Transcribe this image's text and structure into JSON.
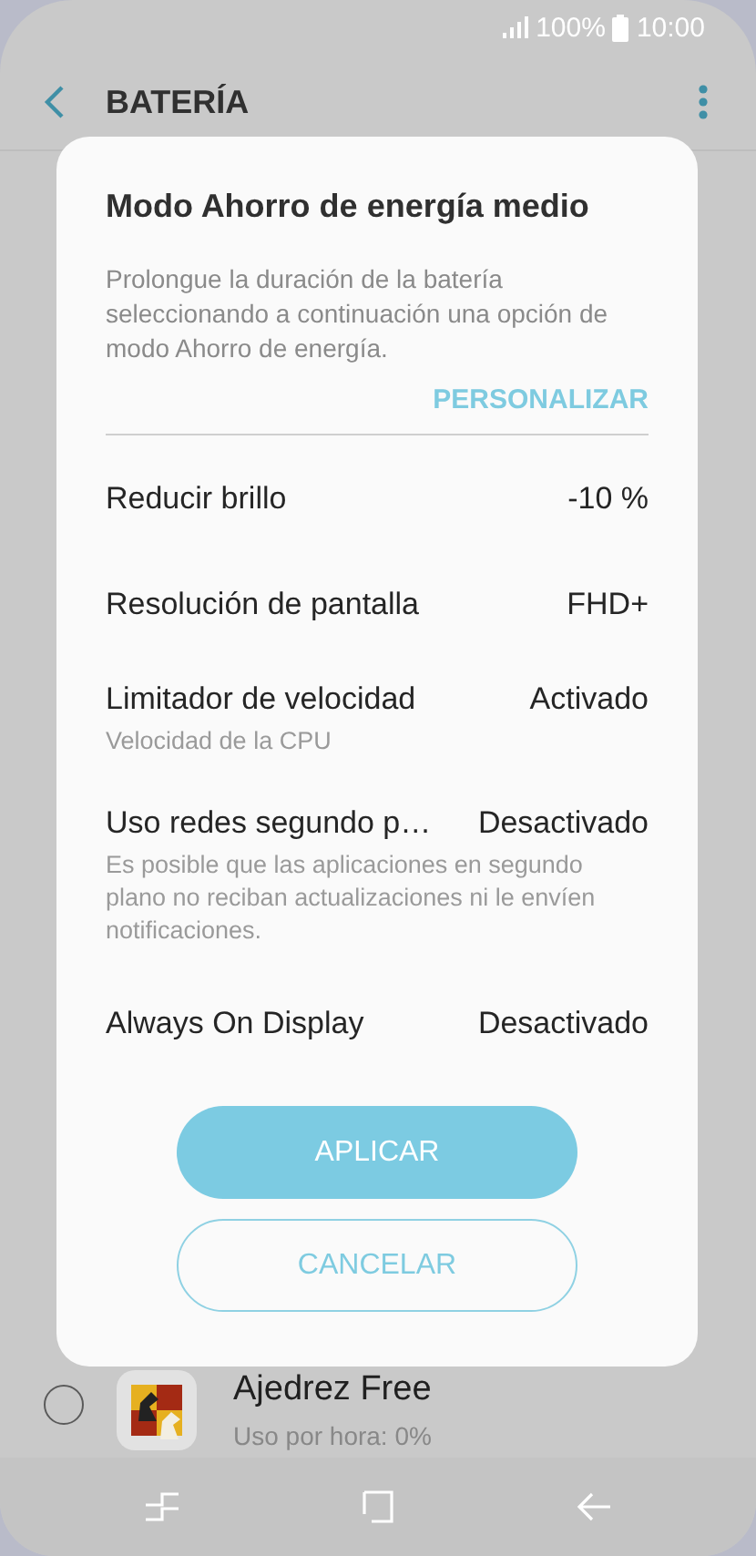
{
  "status_bar": {
    "battery": "100%",
    "time": "10:00"
  },
  "app_bar": {
    "title": "BATERÍA"
  },
  "app_list": [
    {
      "name": "Ajedrez Free",
      "detail": "Uso por hora: 0%",
      "selected": false
    }
  ],
  "dialog": {
    "title": "Modo Ahorro de energía medio",
    "description": "Prolongue la duración de la batería seleccionando a continuación una opción de modo Ahorro de energía.",
    "link": "PERSONALIZAR",
    "settings": [
      {
        "label": "Reducir brillo",
        "value": "-10 %"
      },
      {
        "label": "Resolución de pantalla",
        "value": "FHD+"
      },
      {
        "label": "Limitador de velocidad",
        "value": "Activado",
        "description": "Velocidad de la CPU"
      },
      {
        "label": "Uso redes segundo p…",
        "value": "Desactivado",
        "description": "Es posible que las aplicaciones en segundo plano no reciban actualizaciones ni le envíen notificaciones."
      },
      {
        "label": "Always On Display",
        "value": "Desactivado"
      }
    ],
    "buttons": [
      {
        "label": "APLICAR",
        "kind": "primary"
      },
      {
        "label": "CANCELAR",
        "kind": "outline"
      }
    ]
  }
}
